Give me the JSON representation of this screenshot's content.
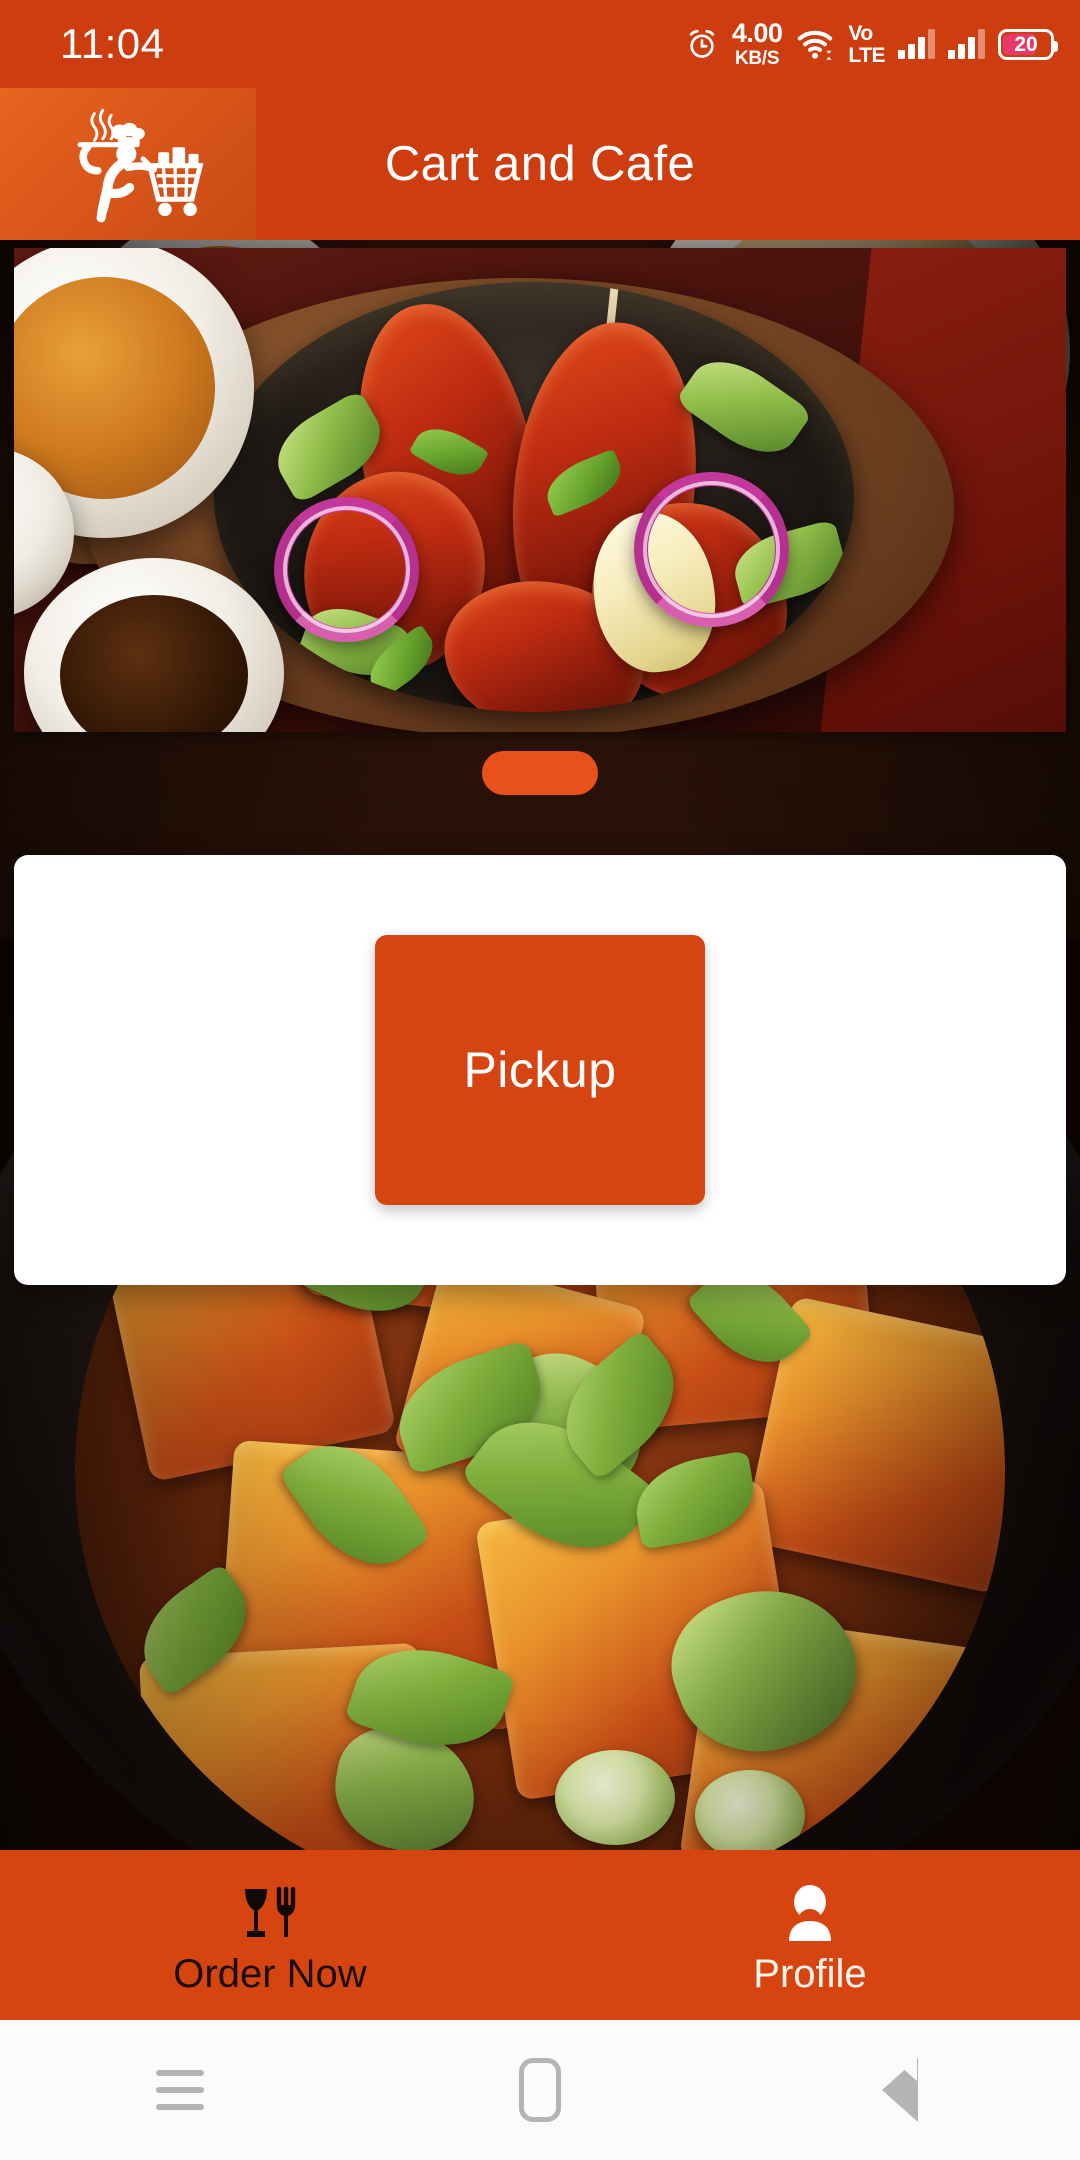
{
  "status_bar": {
    "time": "11:04",
    "alarm_icon": "alarm-clock-icon",
    "net_speed_value": "4.00",
    "net_speed_unit": "KB/S",
    "wifi_icon": "wifi-icon",
    "volte_line1": "Vo",
    "volte_line2": "LTE",
    "signal_icon_1": "cellular-signal-icon",
    "signal_icon_2": "cellular-signal-icon",
    "battery_percent": "20",
    "battery_icon": "battery-icon",
    "background_color": "#CD3D10",
    "battery_fill_color": "#E8396B"
  },
  "app_bar": {
    "title": "Cart and Cafe",
    "logo_icon": "chef-with-shopping-cart-logo",
    "background_color": "#CD3D10",
    "title_color": "#FFFFFF"
  },
  "carousel": {
    "image_alt": "Tandoori chicken sizzler on wooden board with sauce bowls",
    "indicator_color": "#E8511A",
    "indicator_name": "carousel-page-indicator"
  },
  "background": {
    "image_alt": "Chilli paneer in a black bowl"
  },
  "dialog": {
    "card_background": "#FFFFFF",
    "pickup_label": "Pickup",
    "pickup_color": "#D64411",
    "pickup_text_color": "#FFFFFF"
  },
  "tab_bar": {
    "background_color": "#D6450F",
    "tabs": [
      {
        "label": "Order Now",
        "icon": "wine-glass-and-fork-icon",
        "selected": true,
        "color": "#1A0D08"
      },
      {
        "label": "Profile",
        "icon": "person-icon",
        "selected": false,
        "color": "#FDF3EC"
      }
    ]
  },
  "nav_bar": {
    "recents_icon": "recents-menu-icon",
    "home_icon": "home-pill-icon",
    "back_icon": "back-triangle-icon",
    "background_color": "#FBFBFB",
    "icon_color": "#B4B4B4"
  }
}
